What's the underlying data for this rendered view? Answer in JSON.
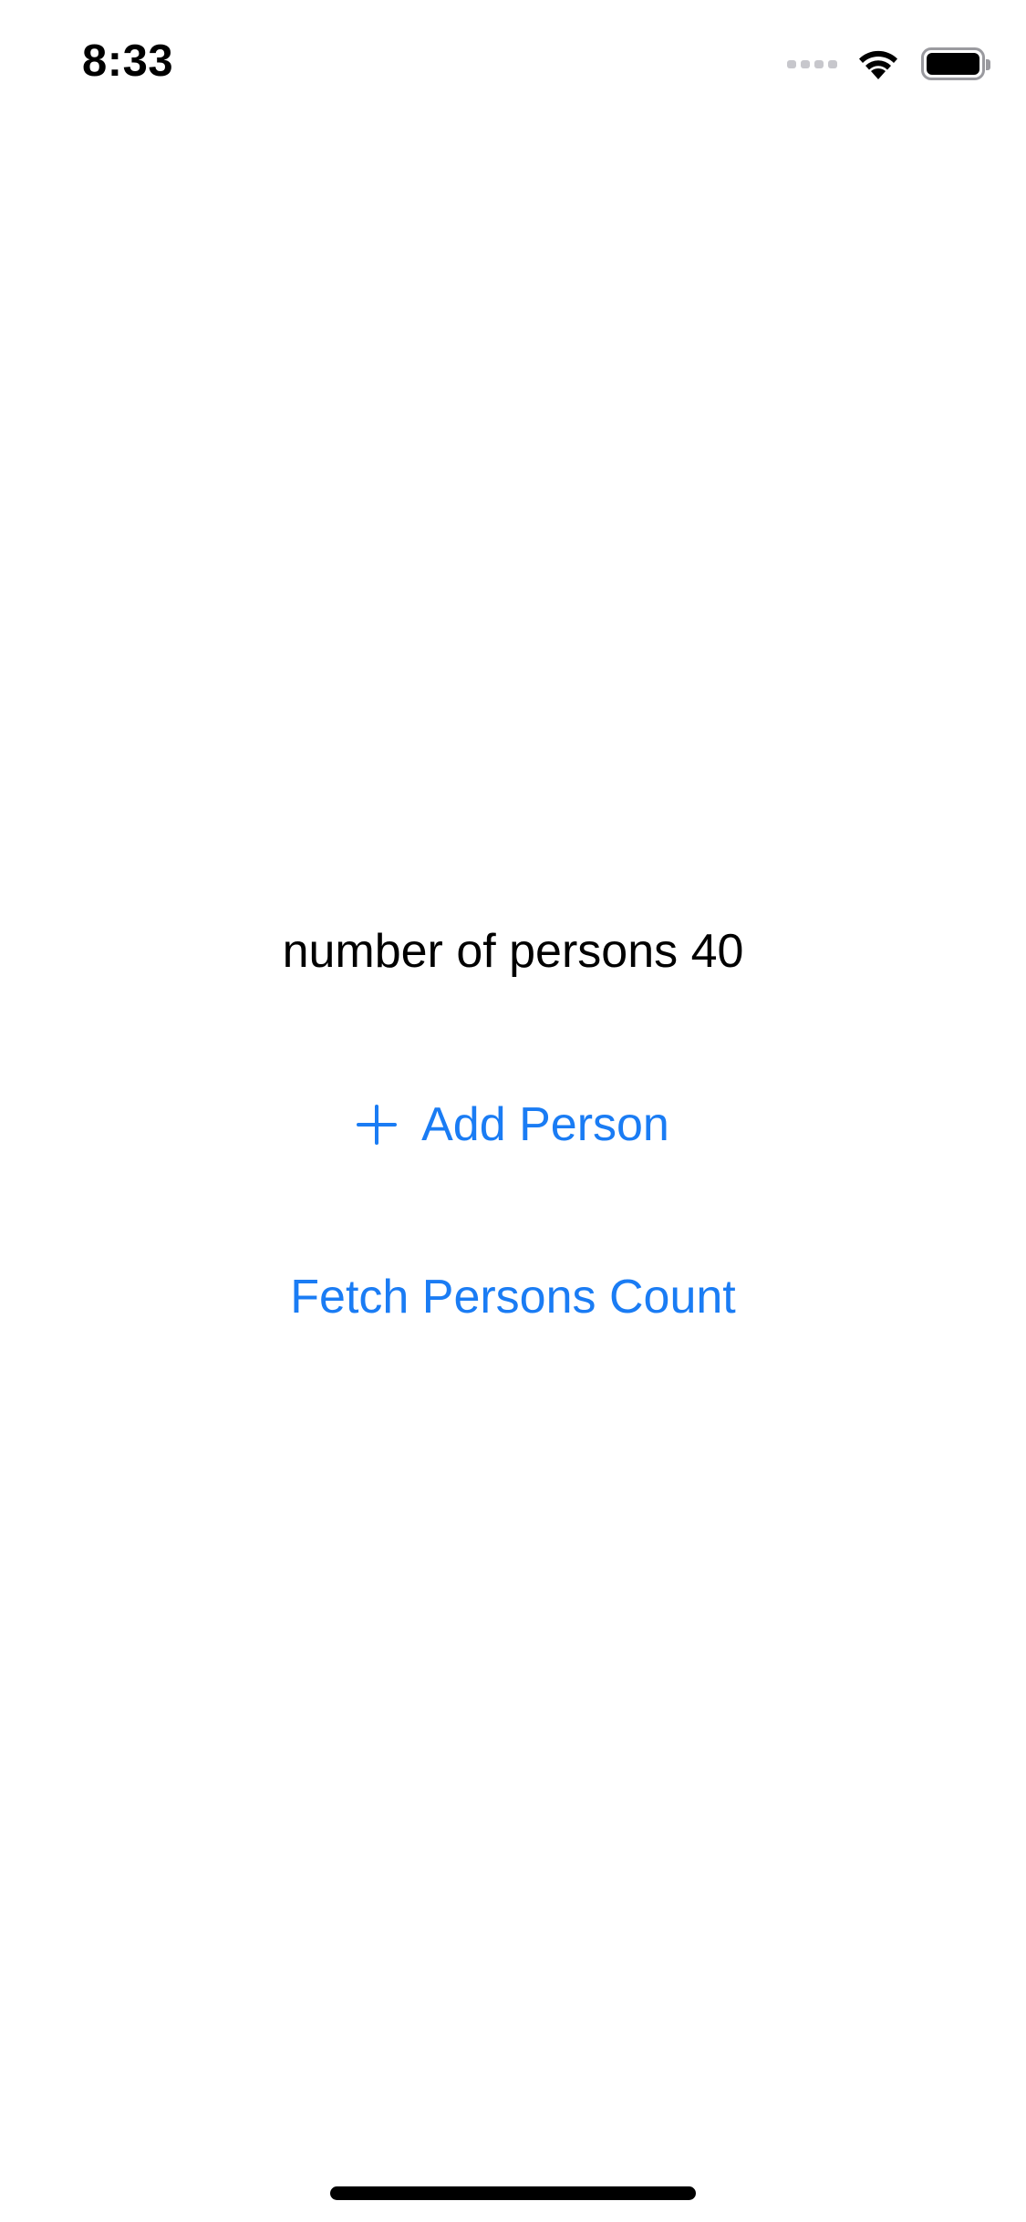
{
  "status_bar": {
    "time": "8:33",
    "icons": [
      "cellular-signal-icon",
      "wifi-icon",
      "battery-icon"
    ]
  },
  "main": {
    "count_label": "number of persons 40",
    "add_button_label": "Add Person",
    "add_button_icon": "plus-icon",
    "fetch_button_label": "Fetch Persons Count"
  },
  "colors": {
    "accent": "#1a7cf4",
    "text": "#000000",
    "background": "#ffffff"
  }
}
